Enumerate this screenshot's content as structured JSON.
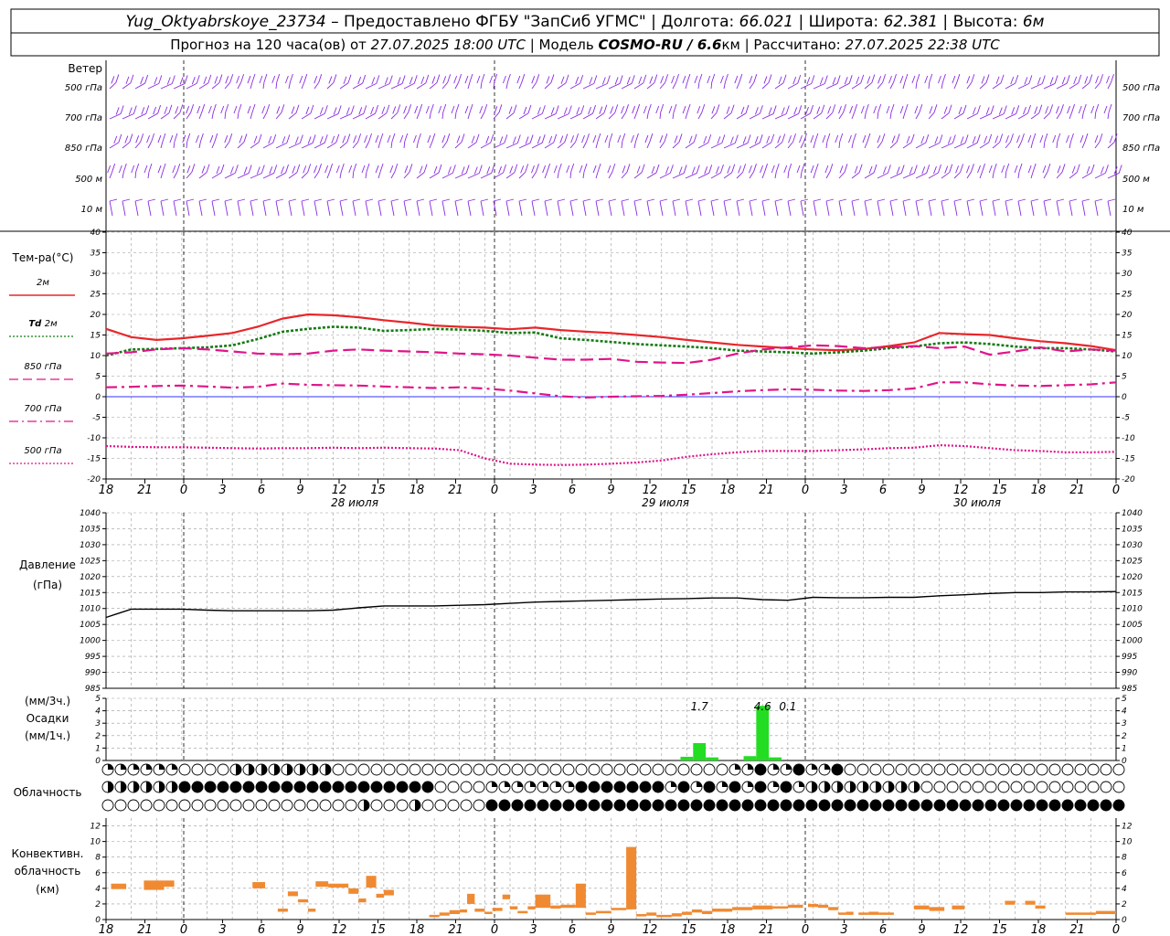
{
  "header": {
    "station": "Yug_Oktyabrskoye_23734",
    "provided_by": "– Предоставлено ФГБУ \"ЗапСиб УГМС\"",
    "longitude_label": "Долгота:",
    "longitude": "66.021",
    "latitude_label": "Широта:",
    "latitude": "62.381",
    "elevation_label": "Высота:",
    "elevation": "6м",
    "forecast_label": "Прогноз на 120 часа(ов) от",
    "forecast_start": "27.07.2025 18:00 UTC",
    "model_label": "Модель",
    "model_name": "COSMO-RU / 6.6",
    "model_unit": "км",
    "computed_label": "Рассчитано:",
    "computed_time": "27.07.2025 22:38 UTC"
  },
  "x_axis": {
    "hour_labels": [
      "18",
      "21",
      "0",
      "3",
      "6",
      "9",
      "12",
      "15",
      "18",
      "21",
      "0",
      "3",
      "6",
      "9",
      "12",
      "15",
      "18",
      "21",
      "0",
      "3",
      "6",
      "9",
      "12",
      "15",
      "18",
      "21",
      "0"
    ],
    "date_labels": [
      "28 июля",
      "29 июля",
      "30 июля"
    ]
  },
  "wind_panel": {
    "title": "Ветер",
    "levels": [
      "500 гПа",
      "700 гПа",
      "850 гПа",
      "500 м",
      "10 м"
    ],
    "color": "#8a2be2"
  },
  "temperature_panel": {
    "title": "Тем-ра(°С)",
    "legend": [
      {
        "label": "2м",
        "color": "#e8262a",
        "style": "solid"
      },
      {
        "label_italic": "Td",
        "label": "2м",
        "color": "#137a13",
        "style": "dotted"
      },
      {
        "label": "850 гПа",
        "color": "#e0148a",
        "style": "dashed"
      },
      {
        "label": "700 гПа",
        "color": "#e0148a",
        "style": "dashdot"
      },
      {
        "label": "500 гПа",
        "color": "#e0148a",
        "style": "fine-dotted"
      }
    ],
    "y_ticks": [
      "40",
      "35",
      "30",
      "25",
      "20",
      "15",
      "10",
      "5",
      "0",
      "-5",
      "-10",
      "-15",
      "-20"
    ]
  },
  "pressure_panel": {
    "title": "Давление",
    "unit": "(гПа)",
    "y_ticks": [
      "1040",
      "1035",
      "1030",
      "1025",
      "1020",
      "1015",
      "1010",
      "1005",
      "1000",
      "995",
      "990",
      "985"
    ]
  },
  "precip_panel": {
    "unit_3h": "(мм/3ч.)",
    "title": "Осадки",
    "unit_1h": "(мм/1ч.)",
    "y_ticks": [
      "5",
      "4",
      "3",
      "2",
      "1",
      "0"
    ],
    "labels": [
      "1.7",
      "4.6",
      "0.1"
    ],
    "color": "#22dd22"
  },
  "cloud_panel": {
    "title": "Облачность"
  },
  "convective_panel": {
    "title_line1": "Конвективн.",
    "title_line2": "облачность",
    "unit": "(км)",
    "y_ticks": [
      "12",
      "10",
      "8",
      "6",
      "4",
      "2",
      "0"
    ],
    "color": "#f08a32"
  },
  "chart_data": [
    {
      "type": "line",
      "name": "temperature",
      "x_hours": [
        0,
        1,
        2,
        3,
        4,
        5,
        6,
        7,
        8,
        9,
        10,
        11,
        12,
        13,
        14,
        15,
        16,
        17,
        18,
        19,
        20,
        21,
        22,
        23,
        24,
        25,
        26,
        27,
        28,
        29,
        30,
        31,
        32,
        33,
        34,
        35,
        36,
        37,
        38,
        39,
        40
      ],
      "ylim": [
        -20,
        40
      ],
      "series": [
        {
          "name": "2м",
          "values": [
            16.5,
            14.5,
            13.8,
            14.2,
            14.8,
            15.5,
            17.0,
            19.0,
            20.0,
            19.8,
            19.3,
            18.6,
            18.0,
            17.3,
            17.0,
            16.8,
            16.4,
            16.8,
            16.2,
            15.8,
            15.5,
            15.0,
            14.5,
            13.8,
            13.2,
            12.6,
            12.2,
            11.8,
            11.5,
            11.3,
            11.6,
            12.3,
            13.2,
            15.5,
            15.2,
            15.0,
            14.2,
            13.5,
            13.0,
            12.3,
            11.3
          ]
        },
        {
          "name": "Td 2м",
          "values": [
            10.0,
            11.5,
            11.6,
            11.8,
            12.0,
            12.5,
            14.0,
            15.8,
            16.5,
            17.0,
            16.8,
            16.0,
            16.2,
            16.5,
            16.3,
            16.0,
            15.5,
            15.6,
            14.2,
            13.8,
            13.3,
            12.8,
            12.5,
            12.2,
            11.8,
            11.2,
            11.0,
            10.8,
            10.5,
            10.8,
            11.2,
            11.8,
            12.2,
            13.0,
            13.2,
            12.8,
            12.2,
            11.8,
            11.8,
            11.5,
            11.0
          ]
        },
        {
          "name": "850 гПа",
          "values": [
            10.5,
            10.8,
            11.5,
            11.8,
            11.5,
            11.0,
            10.5,
            10.3,
            10.5,
            11.2,
            11.5,
            11.2,
            11.0,
            10.8,
            10.5,
            10.3,
            10.0,
            9.5,
            9.0,
            9.0,
            9.2,
            8.5,
            8.3,
            8.2,
            9.0,
            10.5,
            11.5,
            12.0,
            12.5,
            12.3,
            11.8,
            12.0,
            12.3,
            11.8,
            12.2,
            10.2,
            11.0,
            12.0,
            11.0,
            11.5,
            11.2
          ]
        },
        {
          "name": "700 гПа",
          "values": [
            2.3,
            2.4,
            2.6,
            2.7,
            2.5,
            2.2,
            2.4,
            3.2,
            2.9,
            2.8,
            2.7,
            2.5,
            2.3,
            2.1,
            2.3,
            2.0,
            1.5,
            0.8,
            0.1,
            -0.2,
            0.0,
            0.1,
            0.2,
            0.5,
            0.9,
            1.3,
            1.6,
            1.8,
            1.7,
            1.5,
            1.4,
            1.6,
            2.0,
            3.5,
            3.5,
            3.0,
            2.7,
            2.6,
            2.8,
            3.0,
            3.5
          ]
        },
        {
          "name": "500 гПа",
          "values": [
            -12.0,
            -12.2,
            -12.3,
            -12.3,
            -12.4,
            -12.5,
            -12.6,
            -12.5,
            -12.5,
            -12.4,
            -12.5,
            -12.4,
            -12.5,
            -12.6,
            -13.0,
            -15.0,
            -16.3,
            -16.5,
            -16.6,
            -16.5,
            -16.3,
            -16.0,
            -15.5,
            -14.6,
            -14.0,
            -13.5,
            -13.2,
            -13.2,
            -13.2,
            -13.0,
            -12.8,
            -12.5,
            -12.4,
            -11.8,
            -12.0,
            -12.5,
            -13.0,
            -13.2,
            -13.5,
            -13.5,
            -13.4
          ]
        }
      ]
    },
    {
      "type": "line",
      "name": "pressure",
      "x_hours": [
        0,
        1,
        2,
        3,
        4,
        5,
        6,
        7,
        8,
        9,
        10,
        11,
        12,
        13,
        14,
        15,
        16,
        17,
        18,
        19,
        20,
        21,
        22,
        23,
        24,
        25,
        26,
        27,
        28,
        29,
        30,
        31,
        32,
        33,
        34,
        35,
        36,
        37,
        38,
        39,
        40
      ],
      "ylim": [
        985,
        1040
      ],
      "values": [
        1007.2,
        1009.8,
        1009.8,
        1009.8,
        1009.5,
        1009.3,
        1009.3,
        1009.3,
        1009.3,
        1009.5,
        1010.2,
        1010.8,
        1010.8,
        1010.8,
        1011.0,
        1011.2,
        1011.6,
        1012.0,
        1012.2,
        1012.4,
        1012.6,
        1012.8,
        1013.0,
        1013.1,
        1013.3,
        1013.3,
        1012.8,
        1012.6,
        1013.5,
        1013.4,
        1013.4,
        1013.5,
        1013.5,
        1014.0,
        1014.3,
        1014.7,
        1015.0,
        1015.0,
        1015.2,
        1015.2,
        1015.3
      ]
    },
    {
      "type": "bar",
      "name": "precipitation",
      "ylim": [
        0,
        5
      ],
      "bars": [
        {
          "x_hours": 23.0,
          "value": 0.3
        },
        {
          "x_hours": 23.5,
          "value": 1.4
        },
        {
          "x_hours": 24.0,
          "value": 0.25
        },
        {
          "x_hours": 25.5,
          "value": 0.35
        },
        {
          "x_hours": 26.0,
          "value": 4.4
        },
        {
          "x_hours": 26.5,
          "value": 0.25
        }
      ],
      "annotations": [
        {
          "x_hours": 23.5,
          "label": "1.7"
        },
        {
          "x_hours": 26.0,
          "label": "4.6"
        },
        {
          "x_hours": 27.0,
          "label": "0.1"
        }
      ]
    },
    {
      "type": "bar",
      "name": "convective_cloud",
      "ylim": [
        0,
        13
      ],
      "segments": [
        {
          "x0": 0.2,
          "x1": 0.8,
          "lo": 3.9,
          "hi": 4.6
        },
        {
          "x0": 1.5,
          "x1": 2.3,
          "lo": 3.8,
          "hi": 5.0
        },
        {
          "x0": 2.3,
          "x1": 2.7,
          "lo": 4.2,
          "hi": 5.0
        },
        {
          "x0": 5.8,
          "x1": 6.3,
          "lo": 4.0,
          "hi": 4.8
        },
        {
          "x0": 6.8,
          "x1": 7.2,
          "lo": 1.0,
          "hi": 1.4
        },
        {
          "x0": 7.2,
          "x1": 7.6,
          "lo": 3.0,
          "hi": 3.6
        },
        {
          "x0": 7.6,
          "x1": 8.0,
          "lo": 2.2,
          "hi": 2.6
        },
        {
          "x0": 8.0,
          "x1": 8.3,
          "lo": 1.0,
          "hi": 1.4
        },
        {
          "x0": 8.3,
          "x1": 8.8,
          "lo": 4.2,
          "hi": 4.9
        },
        {
          "x0": 8.8,
          "x1": 9.6,
          "lo": 4.1,
          "hi": 4.6
        },
        {
          "x0": 9.6,
          "x1": 10.0,
          "lo": 3.3,
          "hi": 4.0
        },
        {
          "x0": 10.0,
          "x1": 10.3,
          "lo": 2.2,
          "hi": 2.7
        },
        {
          "x0": 10.3,
          "x1": 10.7,
          "lo": 4.1,
          "hi": 5.6
        },
        {
          "x0": 10.7,
          "x1": 11.0,
          "lo": 2.8,
          "hi": 3.3
        },
        {
          "x0": 11.0,
          "x1": 11.4,
          "lo": 3.1,
          "hi": 3.8
        },
        {
          "x0": 12.8,
          "x1": 13.2,
          "lo": 0.3,
          "hi": 0.6
        },
        {
          "x0": 13.2,
          "x1": 13.6,
          "lo": 0.5,
          "hi": 0.9
        },
        {
          "x0": 13.6,
          "x1": 14.0,
          "lo": 0.7,
          "hi": 1.2
        },
        {
          "x0": 14.0,
          "x1": 14.3,
          "lo": 0.9,
          "hi": 1.3
        },
        {
          "x0": 14.3,
          "x1": 14.6,
          "lo": 2.0,
          "hi": 3.3
        },
        {
          "x0": 14.6,
          "x1": 15.0,
          "lo": 1.0,
          "hi": 1.4
        },
        {
          "x0": 15.0,
          "x1": 15.3,
          "lo": 0.7,
          "hi": 1.0
        },
        {
          "x0": 15.3,
          "x1": 15.7,
          "lo": 1.1,
          "hi": 1.5
        },
        {
          "x0": 15.7,
          "x1": 16.0,
          "lo": 2.6,
          "hi": 3.2
        },
        {
          "x0": 16.0,
          "x1": 16.3,
          "lo": 1.3,
          "hi": 1.7
        },
        {
          "x0": 16.3,
          "x1": 16.7,
          "lo": 0.8,
          "hi": 1.1
        },
        {
          "x0": 16.7,
          "x1": 17.0,
          "lo": 1.3,
          "hi": 1.7
        },
        {
          "x0": 17.0,
          "x1": 17.6,
          "lo": 1.5,
          "hi": 3.2
        },
        {
          "x0": 17.6,
          "x1": 18.0,
          "lo": 1.4,
          "hi": 1.8
        },
        {
          "x0": 18.0,
          "x1": 18.6,
          "lo": 1.5,
          "hi": 1.9
        },
        {
          "x0": 18.6,
          "x1": 19.0,
          "lo": 1.5,
          "hi": 4.6
        },
        {
          "x0": 19.0,
          "x1": 19.4,
          "lo": 0.6,
          "hi": 0.9
        },
        {
          "x0": 19.4,
          "x1": 20.0,
          "lo": 0.8,
          "hi": 1.1
        },
        {
          "x0": 20.0,
          "x1": 20.6,
          "lo": 1.2,
          "hi": 1.5
        },
        {
          "x0": 20.6,
          "x1": 21.0,
          "lo": 1.3,
          "hi": 9.3
        },
        {
          "x0": 21.0,
          "x1": 21.4,
          "lo": 0.4,
          "hi": 0.7
        },
        {
          "x0": 21.4,
          "x1": 21.8,
          "lo": 0.5,
          "hi": 0.9
        },
        {
          "x0": 21.8,
          "x1": 22.4,
          "lo": 0.3,
          "hi": 0.6
        },
        {
          "x0": 22.4,
          "x1": 22.8,
          "lo": 0.4,
          "hi": 0.8
        },
        {
          "x0": 22.8,
          "x1": 23.2,
          "lo": 0.6,
          "hi": 1.0
        },
        {
          "x0": 23.2,
          "x1": 23.6,
          "lo": 0.9,
          "hi": 1.3
        },
        {
          "x0": 23.6,
          "x1": 24.0,
          "lo": 0.7,
          "hi": 1.1
        },
        {
          "x0": 24.0,
          "x1": 24.8,
          "lo": 1.0,
          "hi": 1.4
        },
        {
          "x0": 24.8,
          "x1": 25.6,
          "lo": 1.2,
          "hi": 1.6
        },
        {
          "x0": 25.6,
          "x1": 26.4,
          "lo": 1.3,
          "hi": 1.8
        },
        {
          "x0": 26.4,
          "x1": 27.0,
          "lo": 1.4,
          "hi": 1.7
        },
        {
          "x0": 27.0,
          "x1": 27.6,
          "lo": 1.5,
          "hi": 1.9
        },
        {
          "x0": 27.8,
          "x1": 28.2,
          "lo": 1.6,
          "hi": 2.0
        },
        {
          "x0": 28.2,
          "x1": 28.6,
          "lo": 1.5,
          "hi": 1.9
        },
        {
          "x0": 28.6,
          "x1": 29.0,
          "lo": 1.2,
          "hi": 1.6
        },
        {
          "x0": 29.0,
          "x1": 29.3,
          "lo": 0.6,
          "hi": 0.9
        },
        {
          "x0": 29.3,
          "x1": 29.6,
          "lo": 0.6,
          "hi": 1.0
        },
        {
          "x0": 29.8,
          "x1": 30.2,
          "lo": 0.6,
          "hi": 0.9
        },
        {
          "x0": 30.2,
          "x1": 30.6,
          "lo": 0.6,
          "hi": 1.0
        },
        {
          "x0": 30.6,
          "x1": 31.2,
          "lo": 0.6,
          "hi": 0.9
        },
        {
          "x0": 32.0,
          "x1": 32.6,
          "lo": 1.3,
          "hi": 1.8
        },
        {
          "x0": 32.6,
          "x1": 33.2,
          "lo": 1.1,
          "hi": 1.6
        },
        {
          "x0": 33.5,
          "x1": 34.0,
          "lo": 1.3,
          "hi": 1.8
        },
        {
          "x0": 35.6,
          "x1": 36.0,
          "lo": 1.9,
          "hi": 2.4
        },
        {
          "x0": 36.4,
          "x1": 36.8,
          "lo": 1.9,
          "hi": 2.4
        },
        {
          "x0": 36.8,
          "x1": 37.2,
          "lo": 1.4,
          "hi": 1.8
        },
        {
          "x0": 38.0,
          "x1": 39.2,
          "lo": 0.6,
          "hi": 0.9
        },
        {
          "x0": 39.2,
          "x1": 40.0,
          "lo": 0.7,
          "hi": 1.1
        }
      ]
    }
  ]
}
